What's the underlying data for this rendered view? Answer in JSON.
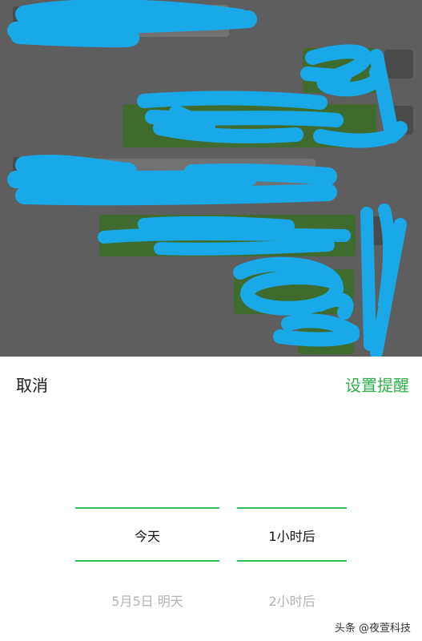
{
  "reminder_sheet": {
    "cancel_label": "取消",
    "confirm_label": "设置提醒",
    "day_column": {
      "selected": "今天",
      "next": "5月5日 明天"
    },
    "time_column": {
      "selected": "1小时后",
      "next": "2小时后"
    }
  },
  "watermark": {
    "text": "头条 @夜萱科技"
  },
  "colors": {
    "accent": "#2bb04a",
    "overlay": "#5e5e5e",
    "redaction": "#1aa9e8"
  }
}
